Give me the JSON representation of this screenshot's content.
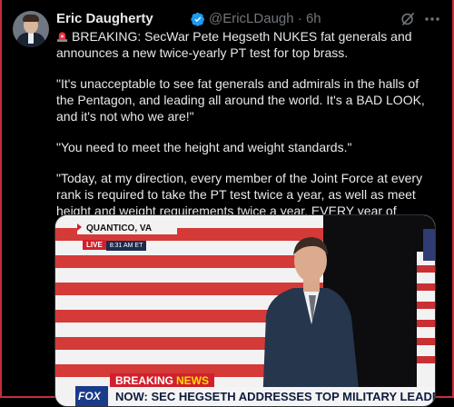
{
  "tweet": {
    "author_name": "Eric Daugherty",
    "handle": "@EricLDaugh",
    "separator": "·",
    "time": "6h",
    "paragraphs": [
      "BREAKING: SecWar Pete Hegseth NUKES fat generals and announces a new twice-yearly PT test for top brass.",
      "\"It's unacceptable to see fat generals and admirals in the halls of the Pentagon, and leading all around the world. It's a BAD LOOK, and it's not who we are!\"",
      "\"You need to meet the height and weight standards.\"",
      "\"Today, at my direction, every member of the Joint Force at every rank is required to take the PT test twice a year, as well as meet height and weight requirements twice a year. EVERY year of service.\""
    ]
  },
  "media": {
    "location": "QUANTICO, VA",
    "live_label": "LIVE",
    "live_time": "8:31 AM ET",
    "breaking_label": "BREAKING",
    "news_label": "NEWS",
    "network": "FOX",
    "headline": "NOW: SEC HEGSETH ADDRESSES TOP MILITARY LEADERS"
  },
  "colors": {
    "accent_blue": "#1d9bf0",
    "muted_text": "#71767b",
    "fox_red": "#d1202d"
  },
  "icons": [
    "verified-badge-icon",
    "grok-icon",
    "more-icon",
    "siren-emoji-icon"
  ]
}
